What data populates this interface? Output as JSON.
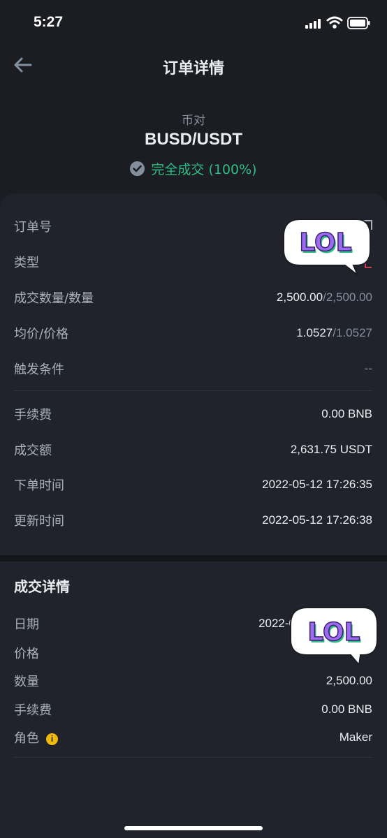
{
  "status_bar": {
    "time": "5:27"
  },
  "header": {
    "title": "订单详情"
  },
  "summary": {
    "pair_label": "币对",
    "pair": "BUSD/USDT",
    "status": "完全成交 (100%)"
  },
  "order": {
    "order_no_label": "订单号",
    "order_no_value": "(",
    "type_label": "类型",
    "filled_label": "成交数量/数量",
    "filled_value": "2,500.00",
    "amount_value": "/2,500.00",
    "avg_label": "均价/价格",
    "avg_value": "1.0527",
    "price_value": "/1.0527",
    "trigger_label": "触发条件",
    "trigger_value": "--",
    "fee_label": "手续费",
    "fee_value": "0.00 BNB",
    "total_label": "成交额",
    "total_value": "2,631.75 USDT",
    "created_label": "下单时间",
    "created_value": "2022-05-12 17:26:35",
    "updated_label": "更新时间",
    "updated_value": "2022-05-12 17:26:38"
  },
  "trade": {
    "title": "成交详情",
    "date_label": "日期",
    "date_value": "2022-0",
    "price_label": "价格",
    "qty_label": "数量",
    "qty_value": "2,500.00",
    "fee_label": "手续费",
    "fee_value": "0.00 BNB",
    "role_label": "角色",
    "role_value": "Maker"
  },
  "stickers": {
    "text": "LOL"
  },
  "colors": {
    "success": "#2ebd85",
    "warning": "#f0b90b",
    "sticker": "#9d6bf2"
  }
}
